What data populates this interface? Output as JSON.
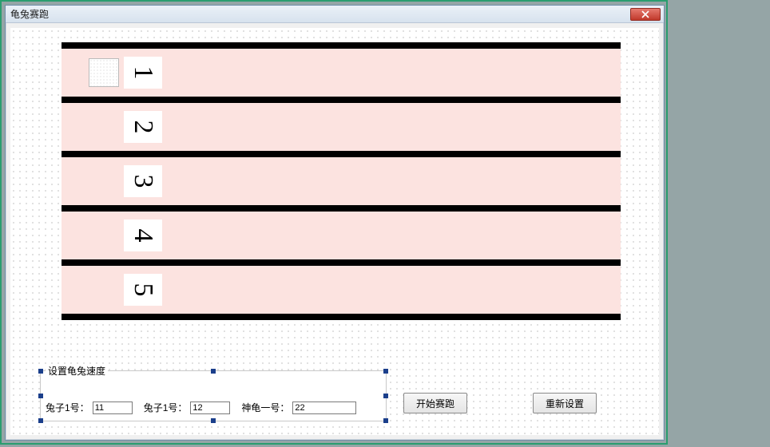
{
  "window": {
    "title": "龟兔赛跑",
    "close_icon": "close"
  },
  "lanes": {
    "items": [
      {
        "num": "1",
        "has_racer": true
      },
      {
        "num": "2",
        "has_racer": false
      },
      {
        "num": "3",
        "has_racer": false
      },
      {
        "num": "4",
        "has_racer": false
      },
      {
        "num": "5",
        "has_racer": false
      }
    ]
  },
  "group": {
    "title": "设置龟兔速度",
    "f1_label": "兔子1号：",
    "f1_value": "11",
    "f2_label": "兔子1号：",
    "f2_value": "12",
    "f3_label": "神龟一号：",
    "f3_value": "22"
  },
  "buttons": {
    "start": "开始赛跑",
    "reset": "重新设置"
  }
}
